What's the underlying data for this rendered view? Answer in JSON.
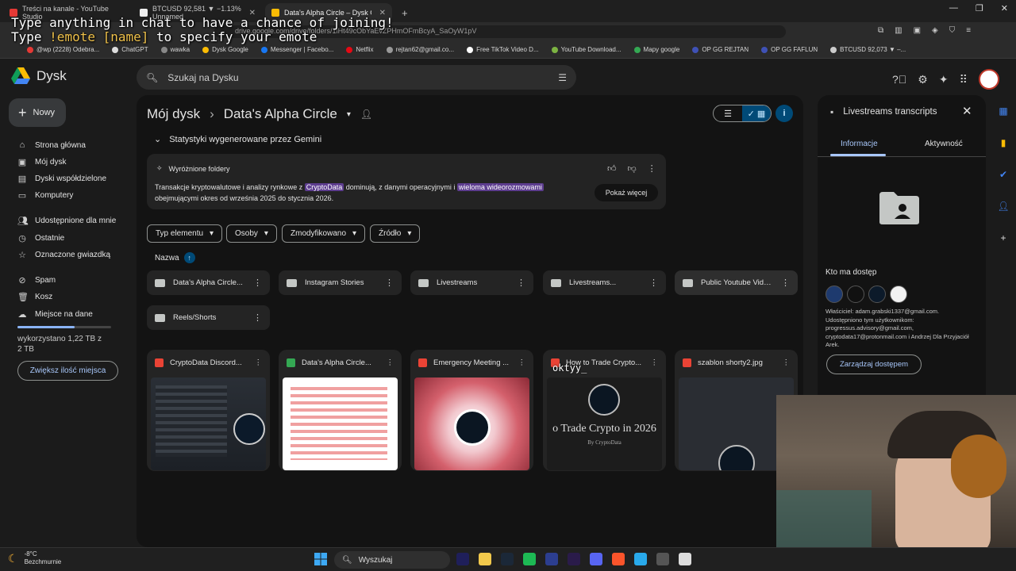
{
  "browser": {
    "tabs": [
      {
        "title": "Treści na kanale - YouTube Studio"
      },
      {
        "title": "BTCUSD 92,581 ▼ −1.13% Unnamed"
      },
      {
        "title": "Data's Alpha Circle – Dysk Google"
      }
    ],
    "url": "drive.google.com/drive/folders/1lHt49cObYaEvZPHmOFmBcyA_SaOyW1pV",
    "bookmarks": [
      "@wp (2228) Odebra...",
      "ChatGPT",
      "wawka",
      "Dysk Google",
      "Messenger | Facebo...",
      "Netflix",
      "rejtan62@gmail.co...",
      "Free TikTok Video D...",
      "YouTube Download...",
      "Mapy google",
      "OP GG REJTAN",
      "OP GG FAFLUN",
      "BTCUSD 92,073 ▼ –..."
    ]
  },
  "overlay": {
    "line1": "Type anything in chat to have a chance of joining!",
    "line2_pre": "Type ",
    "line2_cmd": "!emote [name]",
    "line2_post": " to specify your emote",
    "chat_name": "oktyy_"
  },
  "drive": {
    "app_name": "Dysk",
    "search_placeholder": "Szukaj na Dysku",
    "new_label": "Nowy",
    "nav": [
      "Strona główna",
      "Mój dysk",
      "Dyski współdzielone",
      "Komputery",
      "Udostępnione dla mnie",
      "Ostatnie",
      "Oznaczone gwiazdką",
      "Spam",
      "Kosz",
      "Miejsce na dane"
    ],
    "storage_text": "wykorzystano 1,22 TB z 2 TB",
    "storage_fraction": 0.61,
    "storage_button": "Zwiększ ilość miejsca",
    "breadcrumb": {
      "root": "Mój dysk",
      "current": "Data's Alpha Circle"
    },
    "gemini": {
      "header": "Statystyki wygenerowane przez Gemini",
      "card_title": "Wyróżnione foldery",
      "text_1": "Transakcje kryptowalutowe i analizy rynkowe z ",
      "hl_1": "CryptoData",
      "text_2": " dominują, z danymi operacyjnymi i ",
      "hl_2": "wieloma wideorozmowami",
      "text_3": " obejmującymi okres od września 2025 do stycznia 2026.",
      "show_more": "Pokaż więcej"
    },
    "filters": [
      "Typ elementu",
      "Osoby",
      "Zmodyfikowano",
      "Źródło"
    ],
    "sort_label": "Nazwa",
    "folders": [
      "Data's Alpha Circle...",
      "Instagram Stories",
      "Livestreams",
      "Livestreams...",
      "Public Youtube Videos",
      "Reels/Shorts"
    ],
    "files": [
      "CryptoData Discord...",
      "Data's Alpha Circle...",
      "Emergency Meeting ...",
      "How to Trade Crypto...",
      "szablon shorty2.jpg"
    ],
    "thumb_text": {
      "how_to_big": "o Trade Crypto in 2026",
      "how_to_small": "By CryptoData"
    },
    "panel": {
      "title": "Livestreams transcripts",
      "tab_info": "Informacje",
      "tab_activity": "Aktywność",
      "access_heading": "Kto ma dostęp",
      "owner_text": "Właściciel: adam.grabski1337@gmail.com. Udostępniono tym użytkownikom: progressus.advisory@gmail.com, cryptodata17@protonmail.com i Andrzej Dla Przyjaciół Arek.",
      "manage_button": "Zarządzaj dostępem"
    }
  },
  "taskbar": {
    "temperature": "-8°C",
    "weather": "Bezchmurnie",
    "search": "Wyszukaj"
  },
  "colors": {
    "accent": "#a8c7fa",
    "highlight": "#5d3d8f",
    "selected": "#004a77"
  }
}
